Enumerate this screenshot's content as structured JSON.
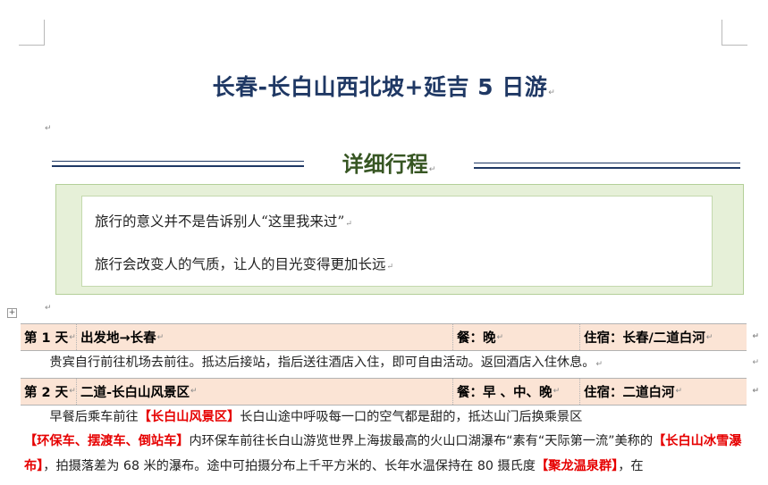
{
  "document": {
    "title": "长春-长白山西北坡+延吉 5 日游",
    "section_heading": "详细行程",
    "quote_lines": [
      "旅行的意义并不是告诉别人“这里我来过”",
      "旅行会改变人的气质，让人的目光变得更加长远"
    ]
  },
  "itinerary": {
    "day1": {
      "day": "第 1 天",
      "route": "出发地→长春",
      "meals": "餐：晚",
      "stay": "住宿：长春/二道白河",
      "description": "贵宾自行前往机场去前往。抵达后接站，指后送往酒店入住，即可自由活动。返回酒店入住休息。"
    },
    "day2": {
      "day": "第 2 天",
      "route": "二道-长白山风景区",
      "meals": "餐：早 、中、晚",
      "stay": "住宿：二道白河",
      "description": {
        "t1": "早餐后乘车前往",
        "h1": "【长白山风景区】",
        "t2": "长白山途中呼吸每一口的空气都是甜的，抵达山门后换乘景区",
        "h2": "【环保车、摆渡车、倒站车】",
        "t3": "内环保车前往长白山游览世界上海拔最高的火山口湖瀑布“素有“天际第一流”美称的",
        "h3": "【长白山冰雪瀑布】",
        "t4": "，拍摄落差为 68 米的瀑布。途中可拍摄分布上千平方米的、长年水温保持在 80 摄氏度",
        "h4": "【聚龙温泉群】",
        "t5": "，在"
      }
    }
  },
  "marks": {
    "paragraph": "↵",
    "table_move": "+"
  }
}
